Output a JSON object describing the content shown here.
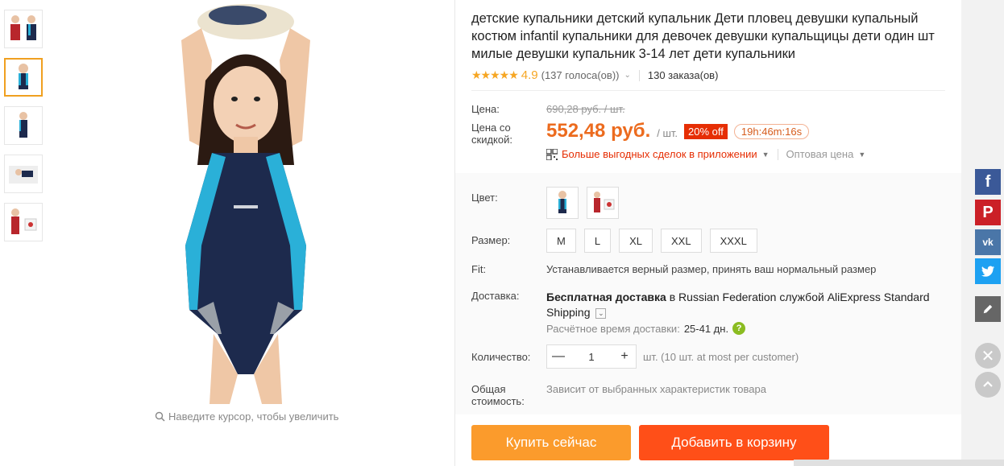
{
  "thumbnails": [
    "thumb-1",
    "thumb-2",
    "thumb-3",
    "thumb-4",
    "thumb-5"
  ],
  "zoom_hint": "Наведите курсор, чтобы увеличить",
  "product": {
    "title": "детские купальники детский купальник Дети пловец девушки купальный костюм infantil купальники для девочек девушки купальщицы дети один шт милые девушки купальник 3-14 лет дети купальники",
    "stars": "★★★★★",
    "rating": "4.9",
    "votes": "(137 голоса(ов))",
    "orders": "130 заказа(ов)"
  },
  "price": {
    "price_label": "Цена:",
    "old_price": "690,28 руб. / шт.",
    "discount_label": "Цена со скидкой:",
    "new_price": "552,48 руб.",
    "per_unit": "/ шт.",
    "discount_badge": "20% off",
    "timer": "19h:46m:16s",
    "app_deals": "Больше выгодных сделок в приложении",
    "wholesale": "Оптовая цена"
  },
  "options": {
    "color_label": "Цвет:",
    "size_label": "Размер:",
    "sizes": [
      "M",
      "L",
      "XL",
      "XXL",
      "XXXL"
    ],
    "fit_label": "Fit:",
    "fit_text": "Устанавливается верный размер, принять ваш нормальный размер",
    "shipping_label": "Доставка:",
    "shipping_bold": "Бесплатная доставка",
    "shipping_rest": " в Russian Federation службой AliExpress Standard Shipping",
    "eta_label": "Расчётное время доставки:",
    "eta_value": "25-41 дн.",
    "help": "?",
    "quantity_label": "Количество:",
    "quantity_minus": "—",
    "quantity_value": "1",
    "quantity_plus": "+",
    "quantity_note": "шт. (10 шт. at most per customer)",
    "total_label": "Общая стоимость:",
    "total_text": "Зависит от выбранных характеристик товара"
  },
  "actions": {
    "buy_now": "Купить сейчас",
    "add_to_cart": "Добавить в корзину"
  },
  "share": {
    "facebook": "f",
    "pinterest": "P",
    "vk": "vk",
    "close": "✕"
  },
  "colors": {
    "accent_orange": "#ec6b1e",
    "discount_red": "#e62e04",
    "buy_button": "#fb9b2c",
    "cart_button": "#ff4f18",
    "swimsuit_navy": "#1d2a4d",
    "swimsuit_cyan": "#2ab0d8"
  }
}
